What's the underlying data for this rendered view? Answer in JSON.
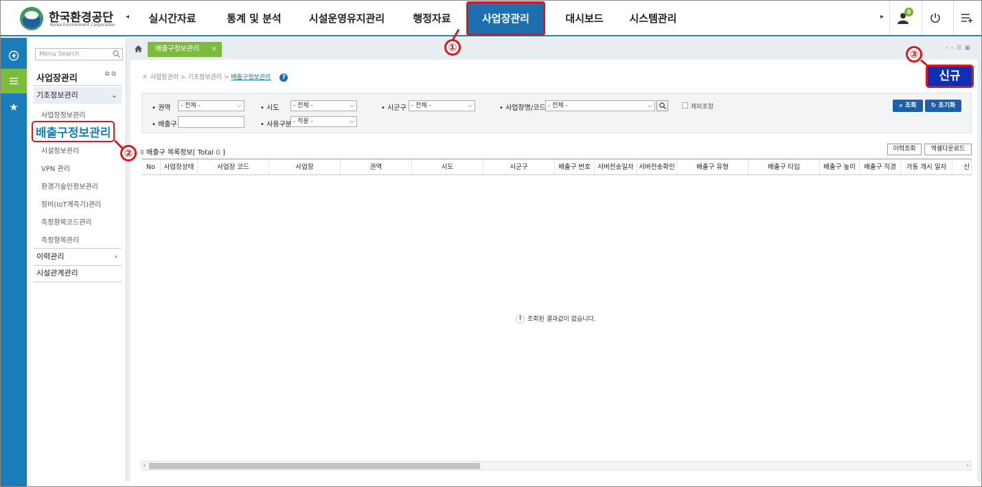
{
  "logo": {
    "title": "한국환경공단",
    "subtitle": "Korea Environment Corporation"
  },
  "nav": {
    "items": [
      "실시간자료",
      "통계 및 분석",
      "시설운영유지관리",
      "행정자료",
      "사업장관리",
      "대시보드",
      "시스템관리"
    ],
    "active": "사업장관리",
    "notification_count": "0"
  },
  "side": {
    "search_placeholder": "Menu Search",
    "title": "사업장관리",
    "groups": [
      {
        "label": "기초정보관리",
        "open": true,
        "items": [
          "사업장정보관리",
          "배출구정보관리",
          "시설정보관리",
          "VPN 관리",
          "환경기술인정보관리",
          "장비(IoT계측기)관리",
          "측정항목코드관리",
          "측정항목관리"
        ]
      },
      {
        "label": "이력관리"
      },
      {
        "label": "시설관계관리"
      }
    ]
  },
  "tab": {
    "label": "배출구정보관리",
    "close": "×"
  },
  "breadcrumb": {
    "root": "사업장관리",
    "sep1": " > ",
    "mid": "기초정보관리",
    "sep2": " > ",
    "current": "배출구정보관리",
    "help": "?"
  },
  "new_button": "신규",
  "filters": {
    "region_label": "권역",
    "region_value": "- 전체 -",
    "sido_label": "시도",
    "sido_value": "- 전체 -",
    "sigungu_label": "시군구",
    "sigungu_value": "- 전체 -",
    "site_label": "사업장명/코드",
    "site_value": "- 전체 -",
    "exclude_label": "제외포함",
    "outlet_label": "배출구",
    "outlet_value": "",
    "use_label": "사용구분",
    "use_value": "- 적용 -",
    "search_button": "조회",
    "reset_button": "초기화"
  },
  "list": {
    "title": "배출구 목록정보",
    "total_prefix": "[ Total ",
    "total": "0",
    "total_suffix": " ]",
    "history_button": "이력조회",
    "excel_button": "엑셀다운로드",
    "columns": [
      "No",
      "사업장상태",
      "사업장 코드",
      "사업장",
      "권역",
      "시도",
      "시군구",
      "배출구 번호",
      "서버전송일자",
      "서버전송확인",
      "배출구 유형",
      "배출구 타입",
      "배출구 높이",
      "배출구 직경",
      "가동 개시 일자",
      "신"
    ],
    "empty_message": "조회된 결과값이 없습니다."
  },
  "markers": [
    "①",
    "②",
    "③"
  ],
  "colors": {
    "primary": "#1d6fb0",
    "tab_green": "#7dbb3a",
    "highlight_red": "#e0141b",
    "new_button": "#0c2fb5"
  }
}
